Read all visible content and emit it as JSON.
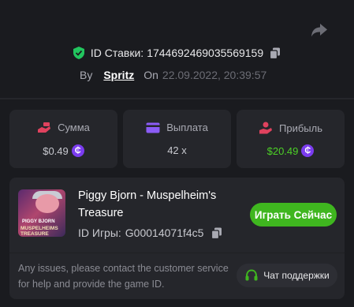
{
  "bet": {
    "id_label": "ID Ставки:",
    "id_value": "1744692469035569159",
    "by_label": "By",
    "username": "Spritz",
    "on_label": "On",
    "datetime": "22.09.2022, 20:39:57"
  },
  "stats": [
    {
      "label": "Сумма",
      "value": "$0.49",
      "icon": "money-hand-icon",
      "coin": true,
      "value_color": "#c8c9cf"
    },
    {
      "label": "Выплата",
      "value": "42 x",
      "icon": "credit-card-icon",
      "coin": false,
      "value_color": "#c8c9cf"
    },
    {
      "label": "Прибыль",
      "value": "$20.49",
      "icon": "profit-hand-icon",
      "coin": true,
      "value_color": "#4cd126"
    }
  ],
  "coin_symbol": "₵",
  "game": {
    "title": "Piggy Bjorn - Muspelheim's Treasure",
    "id_label": "ID Игры:",
    "id_value": "G00014071f4c5",
    "play_label": "Играть Сейчас",
    "thumb_text_top": "PIGGY BJORN",
    "thumb_text_main": "MUSPELHEIMS TREASURE"
  },
  "support": {
    "issue_text": "Any issues, please contact the customer service for help and provide the game ID.",
    "button_label": "Чат поддержки"
  },
  "colors": {
    "background": "#1a1b1f",
    "card": "#25262b",
    "accent_green": "#3fb61f",
    "profit_green": "#4cd126",
    "coin_purple": "#7b3cf0",
    "shield_green": "#22c55e"
  }
}
